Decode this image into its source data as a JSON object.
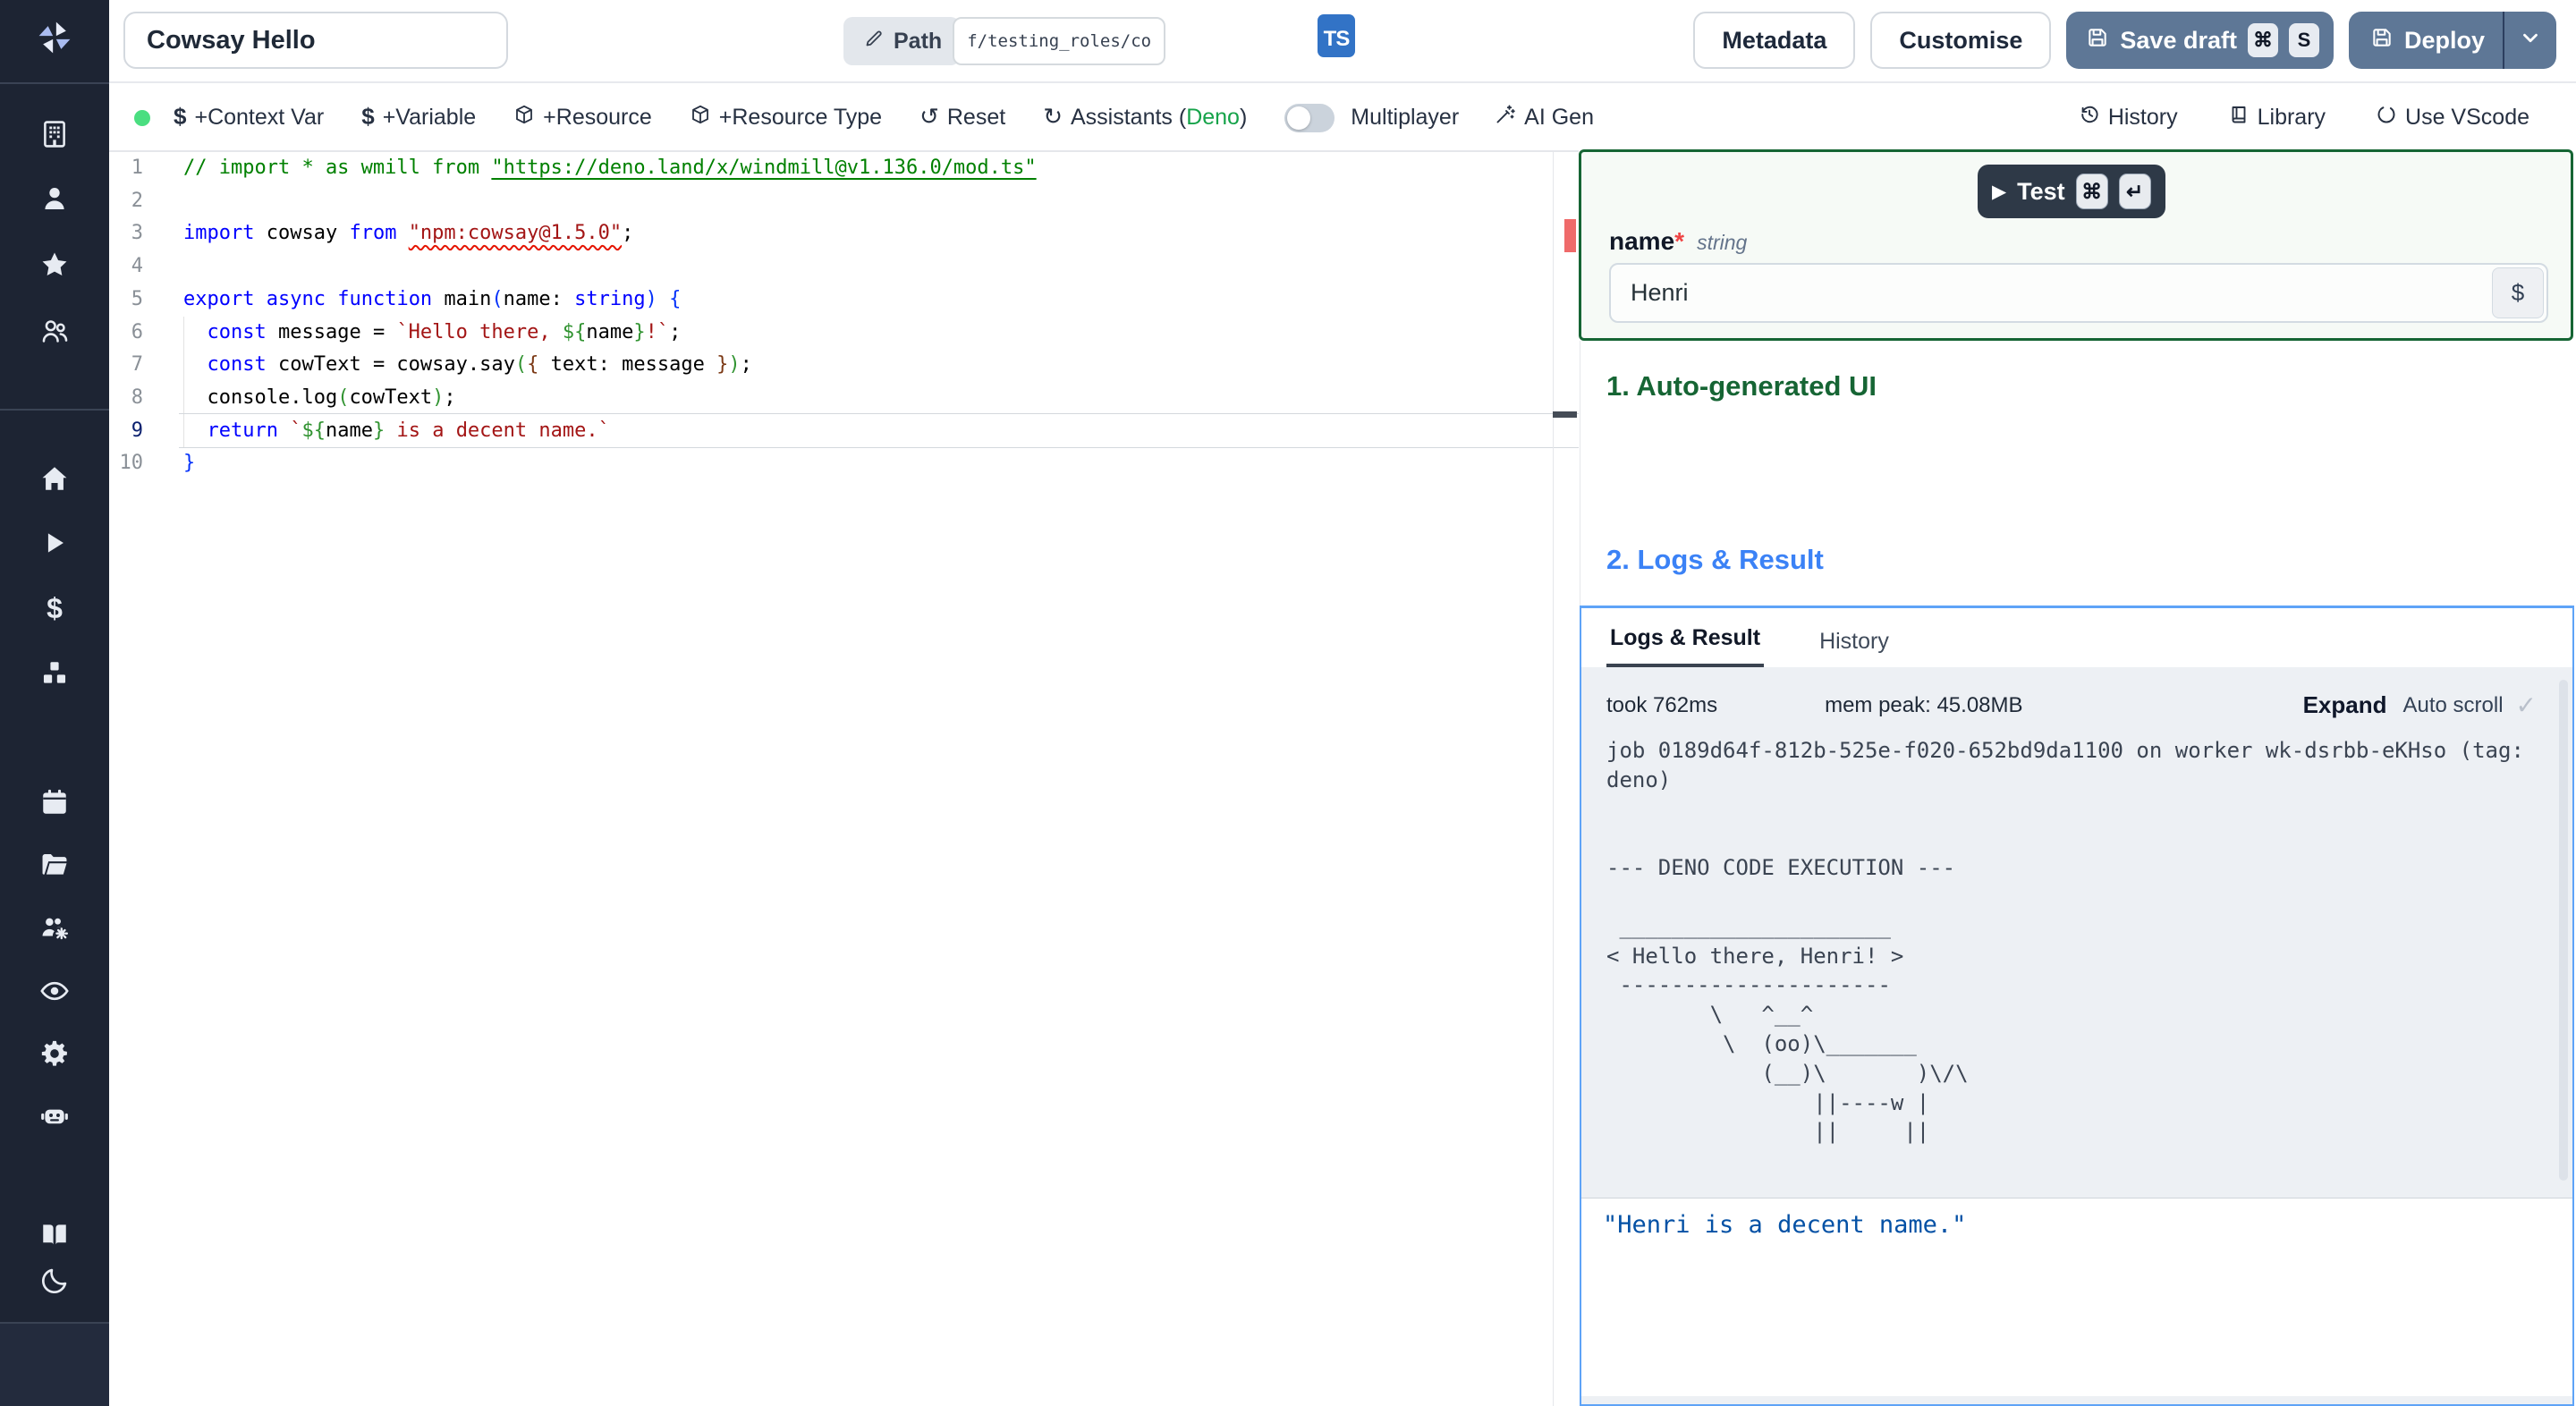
{
  "header": {
    "title_value": "Cowsay Hello",
    "path_label": "Path",
    "path_value": "f/testing_roles/cowsa",
    "lang_badge": "TS",
    "metadata": "Metadata",
    "customise": "Customise",
    "save_draft": "Save draft",
    "save_keys": [
      "⌘",
      "S"
    ],
    "deploy": "Deploy"
  },
  "toolbar": {
    "left": [
      {
        "icon": "dollar-icon",
        "label": "+Context Var"
      },
      {
        "icon": "dollar-icon",
        "label": "+Variable"
      },
      {
        "icon": "package-icon",
        "label": "+Resource"
      },
      {
        "icon": "package-icon",
        "label": "+Resource Type"
      },
      {
        "icon": "reset-icon",
        "label": "Reset"
      },
      {
        "icon": "refresh-icon",
        "label": "Assistants (",
        "accent": "Deno",
        "suffix": ")"
      }
    ],
    "multiplayer": "Multiplayer",
    "ai_gen": "AI Gen",
    "history": "History",
    "library": "Library",
    "vscode": "Use VScode"
  },
  "sidebar": {
    "items": [
      "windmill-logo",
      "workspace-building-icon",
      "user-icon",
      "favorites-star-icon",
      "groups-icon",
      "home-icon",
      "runs-play-icon",
      "variables-dollar-icon",
      "resources-cubes-icon",
      "schedules-calendar-icon",
      "folders-icon",
      "workers-group-gear-icon",
      "audit-logs-eye-icon",
      "settings-gear-icon",
      "workers-robot-icon",
      "docs-book-icon",
      "dark-mode-moon-icon",
      "collapse-sidebar-arrow-icon"
    ]
  },
  "editor": {
    "lines": [
      {
        "n": "1",
        "tokens": [
          [
            "// import * as wmill from ",
            "cm"
          ],
          [
            "\"https://deno.land/x/windmill@v1.136.0/mod.ts\"",
            "cml"
          ]
        ]
      },
      {
        "n": "2",
        "tokens": []
      },
      {
        "n": "3",
        "tokens": [
          [
            "import",
            "kw"
          ],
          [
            " cowsay ",
            "pl"
          ],
          [
            "from",
            "kw"
          ],
          [
            " ",
            "pl"
          ],
          [
            "\"npm:cowsay@1.5.0\"",
            "se"
          ],
          [
            ";",
            "pl"
          ]
        ]
      },
      {
        "n": "4",
        "tokens": []
      },
      {
        "n": "5",
        "tokens": [
          [
            "export",
            "kw"
          ],
          [
            " ",
            "pl"
          ],
          [
            "async",
            "kw"
          ],
          [
            " ",
            "pl"
          ],
          [
            "function",
            "kw"
          ],
          [
            " main",
            "pl"
          ],
          [
            "(",
            "b1"
          ],
          [
            "name: ",
            "pl"
          ],
          [
            "string",
            "kw"
          ],
          [
            ")",
            "b1"
          ],
          [
            " ",
            "pl"
          ],
          [
            "{",
            "b1"
          ]
        ]
      },
      {
        "n": "6",
        "tokens": [
          [
            "  ",
            "pl"
          ],
          [
            "const",
            "kw"
          ],
          [
            " message = ",
            "pl"
          ],
          [
            "`Hello there, ",
            "st"
          ],
          [
            "${",
            "b2"
          ],
          [
            "name",
            "pl"
          ],
          [
            "}",
            "b2"
          ],
          [
            "!`",
            "st"
          ],
          [
            ";",
            "pl"
          ]
        ]
      },
      {
        "n": "7",
        "tokens": [
          [
            "  ",
            "pl"
          ],
          [
            "const",
            "kw"
          ],
          [
            " cowText = cowsay.say",
            "pl"
          ],
          [
            "(",
            "b2"
          ],
          [
            "{",
            "b3"
          ],
          [
            " text: message ",
            "pl"
          ],
          [
            "}",
            "b3"
          ],
          [
            ")",
            "b2"
          ],
          [
            ";",
            "pl"
          ]
        ]
      },
      {
        "n": "8",
        "tokens": [
          [
            "  console.log",
            "pl"
          ],
          [
            "(",
            "b2"
          ],
          [
            "cowText",
            "pl"
          ],
          [
            ")",
            "b2"
          ],
          [
            ";",
            "pl"
          ]
        ]
      },
      {
        "n": "9",
        "tokens": [
          [
            "  ",
            "pl"
          ],
          [
            "return",
            "kw"
          ],
          [
            " ",
            "pl"
          ],
          [
            "`",
            "st"
          ],
          [
            "${",
            "b2"
          ],
          [
            "name",
            "pl"
          ],
          [
            "}",
            "b2"
          ],
          [
            " is a decent name.`",
            "st"
          ]
        ]
      },
      {
        "n": "10",
        "tokens": [
          [
            "}",
            "b1"
          ]
        ]
      }
    ],
    "active_line": 9
  },
  "run_panel": {
    "test": "Test",
    "test_keys": [
      "⌘",
      "↵"
    ],
    "field": {
      "name": "name",
      "required": "*",
      "type": "string",
      "value": "Henri",
      "dollar": "$"
    },
    "section1": "1. Auto-generated UI",
    "section2": "2. Logs & Result",
    "tabs": [
      "Logs & Result",
      "History"
    ],
    "meta": {
      "took": "took 762ms",
      "mem": "mem peak: 45.08MB",
      "expand": "Expand",
      "autoscroll": "Auto scroll",
      "check": "✓"
    },
    "log_lines": [
      "job 0189d64f-812b-525e-f020-652bd9da1100 on worker wk-dsrbb-eKHso (tag:",
      "deno)",
      "",
      "",
      "--- DENO CODE EXECUTION ---",
      "",
      " _____________________",
      "< Hello there, Henri! >",
      " ---------------------",
      "        \\   ^__^",
      "         \\  (oo)\\_______",
      "            (__)\\       )\\/\\",
      "                ||----w |",
      "                ||     ||"
    ],
    "result": "\"Henri is a decent name.\""
  },
  "colors": {
    "sidebar_bg": "#1d2433",
    "accent_green_border": "#166534",
    "section_blue": "#3b82f6",
    "panel_border_blue": "#5ea3f7",
    "ts_badge_blue": "#3273c6",
    "button_slate": "#5e7796",
    "status_dot_green": "#4ade80",
    "deno_green": "#16a34a",
    "error_marker_red": "#ef6a6a",
    "result_string_blue": "#0451a5"
  }
}
